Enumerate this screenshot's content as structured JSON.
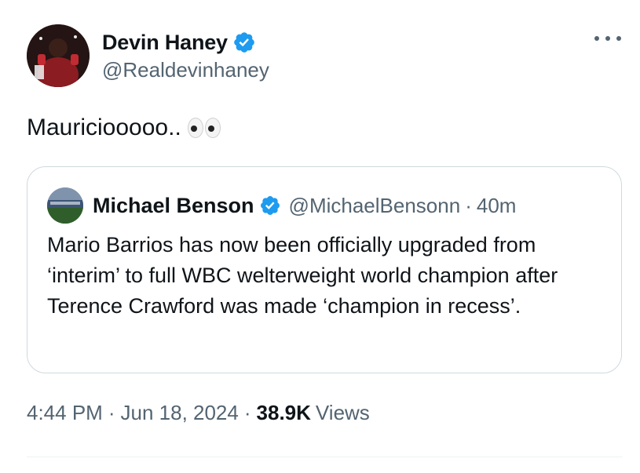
{
  "author": {
    "display_name": "Devin Haney",
    "handle": "@Realdevinhaney",
    "verified": true
  },
  "tweet": {
    "text": "Mauriciooooo..",
    "emoji_icon": "eyes-emoji-icon"
  },
  "quoted_tweet": {
    "display_name": "Michael Benson",
    "handle": "@MichaelBensonn",
    "separator": "·",
    "time": "40m",
    "verified": true,
    "text": "Mario Barrios has now been officially upgraded from ‘interim’ to full WBC welterweight world champion after Terence Crawford was made ‘champion in recess’."
  },
  "meta": {
    "time": "4:44 PM",
    "sep1": "·",
    "date": "Jun 18, 2024",
    "sep2": "·",
    "views_count": "38.9K",
    "views_label": "Views"
  },
  "colors": {
    "verified_blue": "#1d9bf0",
    "secondary_text": "#536471",
    "primary_text": "#0f1419",
    "border": "#cfd9de"
  }
}
